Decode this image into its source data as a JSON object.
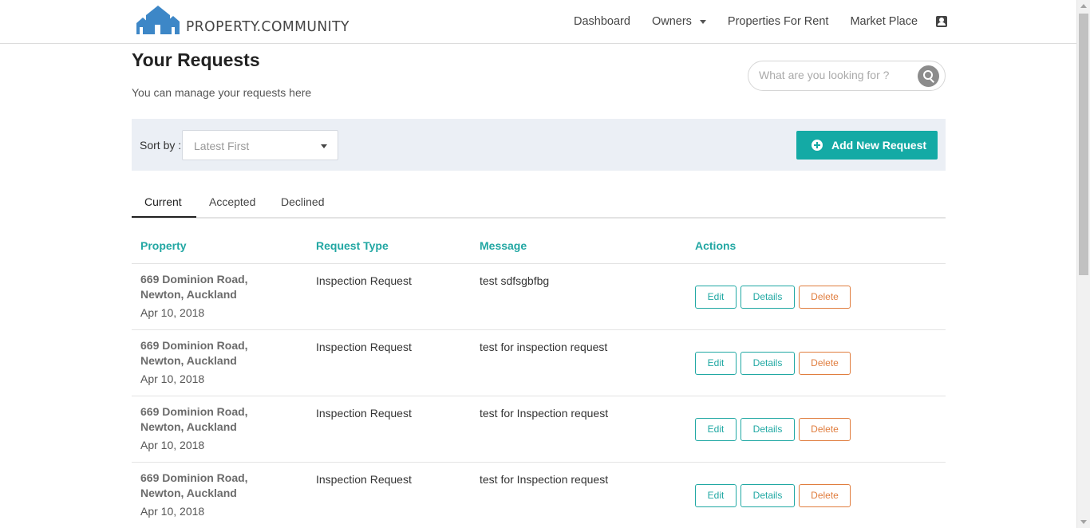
{
  "brand": {
    "name": "PROPERTY.COMMUNITY",
    "accent": "#4a90d9"
  },
  "nav": {
    "items": [
      "Dashboard",
      "Owners",
      "Properties For Rent",
      "Market Place"
    ],
    "user_icon": "account-box-icon"
  },
  "header": {
    "title": "Your Requests",
    "subtitle": "You can manage your requests here",
    "search_placeholder": "What are you looking for ?"
  },
  "sort": {
    "label": "Sort by :",
    "selected": "Latest First"
  },
  "add_button": {
    "label": "Add New Request",
    "color": "#14aaa5"
  },
  "tabs": [
    {
      "label": "Current",
      "active": true
    },
    {
      "label": "Accepted",
      "active": false
    },
    {
      "label": "Declined",
      "active": false
    }
  ],
  "table": {
    "headers": [
      "Property",
      "Request Type",
      "Message",
      "Actions"
    ],
    "header_color": "#22a7a3",
    "rows": [
      {
        "property": "669 Dominion Road, Newton, Auckland",
        "date": "Apr 10, 2018",
        "type": "Inspection Request",
        "message": "test sdfsgbfbg"
      },
      {
        "property": "669 Dominion Road, Newton, Auckland",
        "date": "Apr 10, 2018",
        "type": "Inspection Request",
        "message": "test for inspection request"
      },
      {
        "property": "669 Dominion Road, Newton, Auckland",
        "date": "Apr 10, 2018",
        "type": "Inspection Request",
        "message": "test for Inspection request"
      },
      {
        "property": "669 Dominion Road, Newton, Auckland",
        "date": "Apr 10, 2018",
        "type": "Inspection Request",
        "message": "test for Inspection request"
      }
    ],
    "actions": {
      "edit": "Edit",
      "details": "Details",
      "delete": "Delete"
    }
  }
}
